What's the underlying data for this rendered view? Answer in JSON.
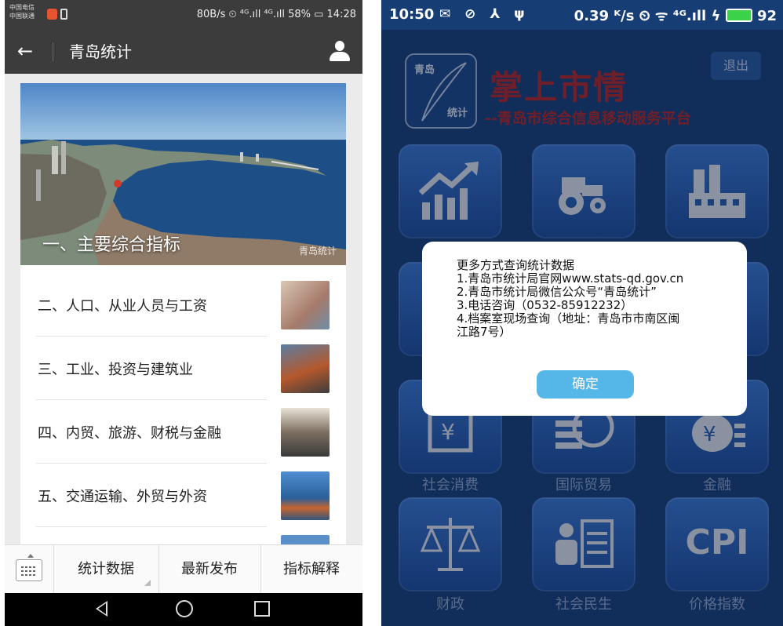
{
  "left": {
    "status_bar": {
      "carrier_1": "中国电信",
      "carrier_2": "中国联通",
      "right_text": "80B/s ⏲ ⁴ᴳ.ıll ⁴ᴳ.ıll 58% ▭ 14:28"
    },
    "app_bar": {
      "back_icon": "arrow-left-icon",
      "title": "青岛统计",
      "user_icon": "user-icon"
    },
    "hero": {
      "title": "一、主要综合指标",
      "watermark": "青岛统计"
    },
    "list_items": [
      {
        "label": "二、人口、从业人员与工资",
        "thumb_color": "#b9a08c"
      },
      {
        "label": "三、工业、投资与建筑业",
        "thumb_color": "#8a5a3a"
      },
      {
        "label": "四、内贸、旅游、财税与金融",
        "thumb_color": "#7e6f5d"
      },
      {
        "label": "五、交通运输、外贸与外资",
        "thumb_color": "#3f79b9"
      }
    ],
    "bottom_menu": {
      "keyboard_icon": "keyboard-icon",
      "tabs": [
        "统计数据",
        "最新发布",
        "指标解释"
      ]
    },
    "nav_bar": {
      "icons": [
        "back-triangle-icon",
        "home-circle-icon",
        "recent-square-icon"
      ]
    }
  },
  "right": {
    "status_bar": {
      "time": "10:50",
      "left_icons": "✉ ⊘ ⅄ ψ",
      "right_text": "0.39 ᴷ/s ⏲ ᯤ ⁴ᴳ.ıll ϟ",
      "battery": "92"
    },
    "header": {
      "logo_top": "青岛",
      "logo_bottom": "统计",
      "title": "掌上市情",
      "subtitle": "--青岛市综合信息移动服务平台",
      "logout": "退出"
    },
    "tiles": [
      {
        "label": "",
        "icon": "growth-chart-icon"
      },
      {
        "label": "",
        "icon": "tractor-icon"
      },
      {
        "label": "",
        "icon": "factory-icon"
      },
      {
        "label": "社会消费",
        "icon": "shopping-bag-icon"
      },
      {
        "label": "国际贸易",
        "icon": "globe-trade-icon"
      },
      {
        "label": "金融",
        "icon": "money-bag-icon"
      },
      {
        "label": "财政",
        "icon": "scales-icon"
      },
      {
        "label": "社会民生",
        "icon": "id-card-icon"
      },
      {
        "label": "价格指数",
        "icon": "cpi-icon",
        "text": "CPI"
      }
    ],
    "dialog": {
      "lines": [
        "更多方式查询统计数据",
        "1.青岛市统计局官网www.stats-qd.gov.cn",
        "2.青岛市统计局微信公众号“青岛统计”",
        "3.电话咨询（0532-85912232）",
        "4.档案室现场查询（地址：青岛市市南区闽",
        "江路7号）"
      ],
      "ok_button": "确定"
    }
  }
}
